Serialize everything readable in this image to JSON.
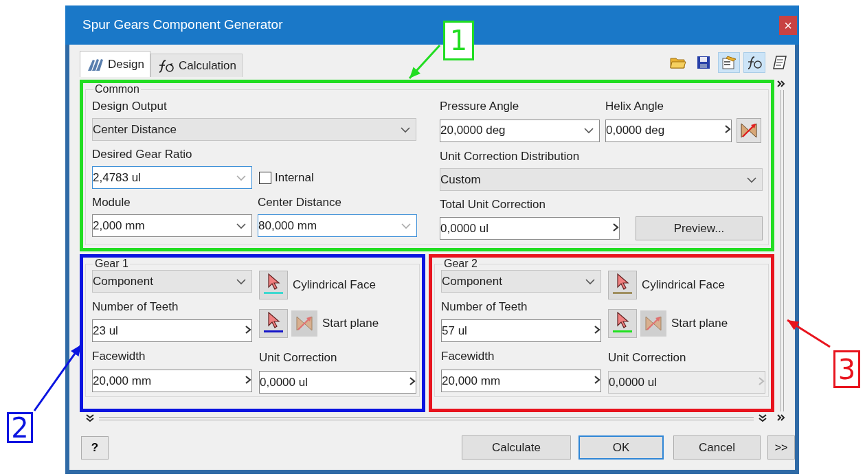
{
  "window": {
    "title": "Spur Gears Component Generator",
    "close": "×"
  },
  "tabs": [
    {
      "label": "Design",
      "selected": true
    },
    {
      "label": "Calculation",
      "selected": false
    }
  ],
  "toolbar": [
    {
      "pressed": false
    },
    {
      "pressed": false
    },
    {
      "pressed": true
    },
    {
      "pressed": true
    },
    {
      "pressed": false
    }
  ],
  "common": {
    "title": "Common",
    "design_output": {
      "label": "Design Output",
      "field": {
        "kind": "select",
        "value": "Center Distance"
      }
    },
    "gear_ratio": {
      "label": "Desired Gear Ratio",
      "field": {
        "kind": "combo",
        "value": "2,4783 ul",
        "focused": true
      }
    },
    "internal": {
      "label": "Internal",
      "checked": false
    },
    "module": {
      "label": "Module",
      "field": {
        "kind": "combo",
        "value": "2,000 mm",
        "focused": false
      }
    },
    "center_distance": {
      "label": "Center Distance",
      "field": {
        "kind": "combo",
        "value": "80,000 mm",
        "focused": true
      }
    },
    "pressure_angle": {
      "label": "Pressure Angle",
      "field": {
        "kind": "combo",
        "value": "20,0000 deg",
        "focused": false
      }
    },
    "helix_angle": {
      "label": "Helix Angle",
      "field": {
        "kind": "entry",
        "value": "0,0000 deg",
        "disabled": false
      }
    },
    "distribution": {
      "label": "Unit Correction Distribution",
      "field": {
        "kind": "select",
        "value": "Custom"
      }
    },
    "total_correction": {
      "label": "Total Unit Correction",
      "field": {
        "kind": "entry",
        "value": "0,0000 ul",
        "disabled": false
      }
    },
    "preview_button": "Preview..."
  },
  "gears": [
    {
      "title": "Gear 1",
      "placement": {
        "kind": "select",
        "value": "Component"
      },
      "face": {
        "label": "Cylindrical Face",
        "color": "#40d8d0"
      },
      "teeth_label": "Number of Teeth",
      "teeth": {
        "kind": "entry",
        "value": "23 ul",
        "disabled": false
      },
      "plane": {
        "label": "Start plane",
        "color": "#1414c8"
      },
      "facewidth_label": "Facewidth",
      "facewidth": {
        "kind": "entry",
        "value": "20,000 mm",
        "disabled": false
      },
      "correction_label": "Unit Correction",
      "correction": {
        "kind": "entry",
        "value": "0,0000 ul",
        "disabled": false
      }
    },
    {
      "title": "Gear 2",
      "placement": {
        "kind": "select",
        "value": "Component"
      },
      "face": {
        "label": "Cylindrical Face",
        "color": "#a09060"
      },
      "teeth_label": "Number of Teeth",
      "teeth": {
        "kind": "entry",
        "value": "57 ul",
        "disabled": false
      },
      "plane": {
        "label": "Start plane",
        "color": "#20e020"
      },
      "facewidth_label": "Facewidth",
      "facewidth": {
        "kind": "entry",
        "value": "20,000 mm",
        "disabled": false
      },
      "correction_label": "Unit Correction",
      "correction": {
        "kind": "entry",
        "value": "0,0000 ul",
        "disabled": true
      }
    }
  ],
  "footer": {
    "help": "?",
    "buttons": [
      {
        "label": "Calculate",
        "default": false
      },
      {
        "label": "OK",
        "default": true
      },
      {
        "label": "Cancel",
        "default": false
      }
    ],
    "more": ">>"
  },
  "annotations": [
    {
      "label": "1",
      "color": "#22dd22"
    },
    {
      "label": "2",
      "color": "#0a14e0"
    },
    {
      "label": "3",
      "color": "#e8141e"
    }
  ]
}
